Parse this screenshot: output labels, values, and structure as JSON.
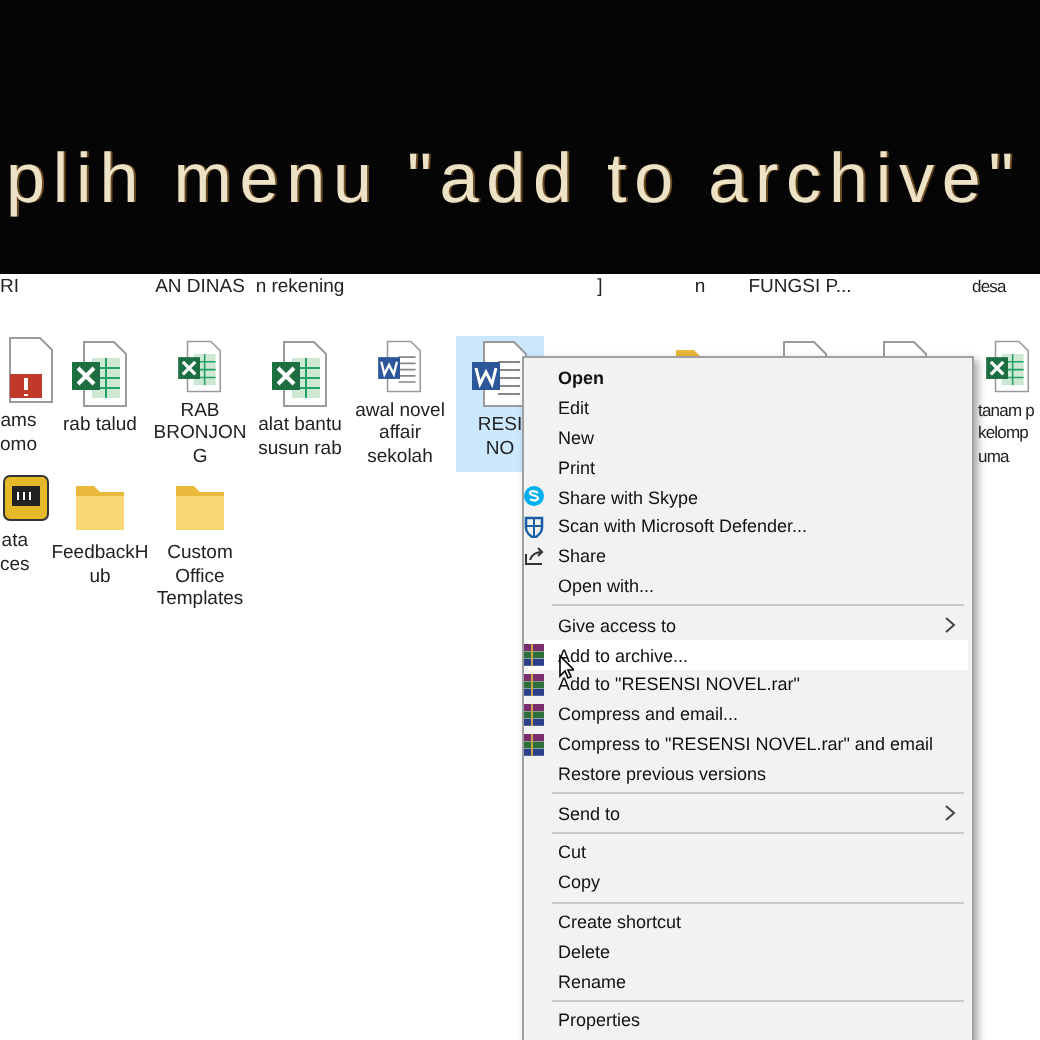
{
  "caption": "plih menu \"add to archive\"",
  "desktop": {
    "rows": [
      [
        {
          "lines": [
            "RI"
          ]
        },
        null,
        {
          "lines": [
            "AN DINAS"
          ]
        },
        {
          "lines": [
            "n rekening"
          ]
        },
        null,
        null,
        {
          "lines": [
            "]"
          ]
        },
        {
          "lines": [
            "n"
          ]
        },
        {
          "lines": [
            "FUNGSI P..."
          ]
        },
        null,
        {
          "lines": [
            "desa"
          ]
        }
      ],
      [
        {
          "kind": "pdf",
          "lines": [
            "ams",
            "omo"
          ],
          "selected": false
        },
        {
          "kind": "excel",
          "lines": [
            "rab talud"
          ],
          "selected": false
        },
        {
          "kind": "excel",
          "lines": [
            "RAB",
            "BRONJON",
            "G"
          ],
          "selected": false
        },
        {
          "kind": "excel",
          "lines": [
            "alat bantu",
            "susun rab"
          ],
          "selected": false
        },
        {
          "kind": "word",
          "lines": [
            "awal novel",
            "affair",
            "sekolah"
          ],
          "selected": false
        },
        {
          "kind": "word",
          "lines": [
            "RESI",
            "NO"
          ],
          "selected": true
        },
        null,
        {
          "kind": "folder",
          "selected": false
        },
        {
          "kind": "pptx",
          "selected": false
        },
        {
          "kind": "excel",
          "selected": false
        },
        {
          "kind": "excel",
          "lines": [
            "tanam p",
            "kelomp",
            "uma"
          ],
          "selected": false
        }
      ],
      [
        {
          "kind": "app",
          "lines": [
            "ata",
            "ces"
          ],
          "selected": false
        },
        {
          "kind": "folder",
          "lines": [
            "FeedbackH",
            "ub"
          ],
          "selected": false
        },
        {
          "kind": "folder",
          "lines": [
            "Custom",
            "Office",
            "Templates"
          ],
          "selected": false
        }
      ]
    ]
  },
  "context_menu": [
    {
      "kind": "item",
      "label": "Open",
      "bold": true,
      "selected": false
    },
    {
      "kind": "item",
      "label": "Edit",
      "bold": false,
      "selected": false
    },
    {
      "kind": "item",
      "label": "New",
      "bold": false,
      "selected": false
    },
    {
      "kind": "item",
      "label": "Print",
      "bold": false,
      "selected": false
    },
    {
      "kind": "skype",
      "label": "Share with Skype",
      "bold": false,
      "selected": false
    },
    {
      "kind": "defender",
      "label": "Scan with Microsoft Defender...",
      "bold": false,
      "selected": false
    },
    {
      "kind": "share",
      "label": "Share",
      "bold": false,
      "selected": false
    },
    {
      "kind": "item",
      "label": "Open with...",
      "bold": false,
      "selected": false
    },
    {
      "kind": "separator"
    },
    {
      "kind": "item",
      "label": "Give access to",
      "submenu": true,
      "bold": false,
      "selected": false
    },
    {
      "kind": "archive",
      "label": "Add to archive...",
      "bold": false,
      "selected": true
    },
    {
      "kind": "archive",
      "label": "Add to \"RESENSI NOVEL.rar\"",
      "bold": false,
      "selected": false
    },
    {
      "kind": "archive",
      "label": "Compress and email...",
      "bold": false,
      "selected": false
    },
    {
      "kind": "archive",
      "label": "Compress to \"RESENSI NOVEL.rar\" and email",
      "bold": false,
      "selected": false
    },
    {
      "kind": "item",
      "label": "Restore previous versions",
      "bold": false,
      "selected": false
    },
    {
      "kind": "separator"
    },
    {
      "kind": "item",
      "label": "Send to",
      "submenu": true,
      "bold": false,
      "selected": false
    },
    {
      "kind": "separator"
    },
    {
      "kind": "item",
      "label": "Cut",
      "bold": false,
      "selected": false
    },
    {
      "kind": "item",
      "label": "Copy",
      "bold": false,
      "selected": false
    },
    {
      "kind": "separator"
    },
    {
      "kind": "item",
      "label": "Create shortcut",
      "bold": false,
      "selected": false
    },
    {
      "kind": "item",
      "label": "Delete",
      "bold": false,
      "selected": false
    },
    {
      "kind": "item",
      "label": "Rename",
      "bold": false,
      "selected": false
    },
    {
      "kind": "separator"
    },
    {
      "kind": "item",
      "label": "Properties",
      "bold": false,
      "selected": false
    }
  ]
}
